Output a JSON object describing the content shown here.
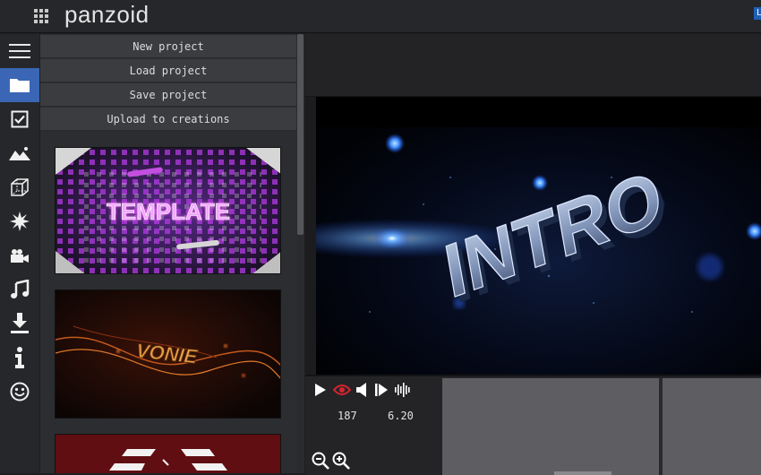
{
  "header": {
    "brand": "panzoid",
    "user_badge": "L"
  },
  "sidebar_icons": [
    "menu-icon",
    "folder-icon",
    "checkbox-icon",
    "image-icon",
    "cube-icon",
    "burst-icon",
    "camera-icon",
    "music-icon",
    "download-icon",
    "info-icon",
    "smiley-icon"
  ],
  "project_menu": {
    "new_project": "New project",
    "load_project": "Load project",
    "save_project": "Save project",
    "upload_creations": "Upload to creations"
  },
  "templates": {
    "thumb1_text": "TEMPLATE",
    "thumb2_text": "VONIE"
  },
  "preview": {
    "title_text": "INTRO"
  },
  "timeline": {
    "frame": "187",
    "time": "6.20"
  },
  "colors": {
    "accent_blue": "#3a66b5",
    "record_red": "#d8242e"
  }
}
